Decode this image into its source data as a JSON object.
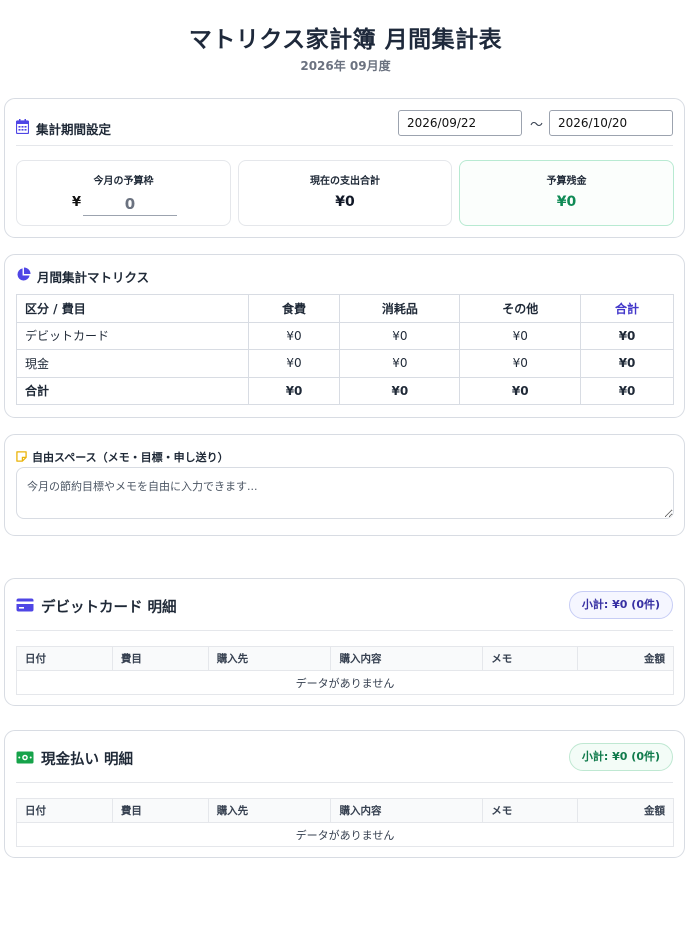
{
  "header": {
    "title": "マトリクス家計簿 月間集計表",
    "subtitle": "2026年 09月度"
  },
  "period": {
    "title": "集計期間設定",
    "icon": "calendar-icon",
    "start_date": "2026/09/22",
    "end_date": "2026/10/20",
    "separator": "〜"
  },
  "stats": {
    "budget_label": "今月の予算枠",
    "yen": "¥",
    "budget_value": "0",
    "expense_label": "現在の支出合計",
    "expense_value": "¥0",
    "remain_label": "予算残金",
    "remain_value": "¥0"
  },
  "matrix": {
    "title": "月間集計マトリクス",
    "icon": "pie-chart-icon",
    "headers": [
      "区分 / 費目",
      "食費",
      "消耗品",
      "その他",
      "合計"
    ],
    "rows": [
      {
        "label": "デビットカード",
        "values": [
          "¥0",
          "¥0",
          "¥0",
          "¥0"
        ]
      },
      {
        "label": "現金",
        "values": [
          "¥0",
          "¥0",
          "¥0",
          "¥0"
        ]
      },
      {
        "label": "合計",
        "values": [
          "¥0",
          "¥0",
          "¥0",
          "¥0"
        ]
      }
    ]
  },
  "memo": {
    "title": "自由スペース（メモ・目標・申し送り）",
    "icon": "sticky-note-icon",
    "placeholder": "今月の節約目標やメモを自由に入力できます..."
  },
  "debit": {
    "title": "デビットカード 明細",
    "icon": "credit-card-icon",
    "subtotal": "小計: ¥0 (0件)",
    "columns": [
      "日付",
      "費目",
      "購入先",
      "購入内容",
      "メモ",
      "金額"
    ],
    "empty_text": "データがありません"
  },
  "cash": {
    "title": "現金払い 明細",
    "icon": "cash-icon",
    "subtotal": "小計: ¥0 (0件)",
    "columns": [
      "日付",
      "費目",
      "購入先",
      "購入内容",
      "メモ",
      "金額"
    ],
    "empty_text": "データがありません"
  },
  "colors": {
    "accent": "#4f46e5",
    "green": "#0f8a55",
    "border": "#d8dce3"
  }
}
